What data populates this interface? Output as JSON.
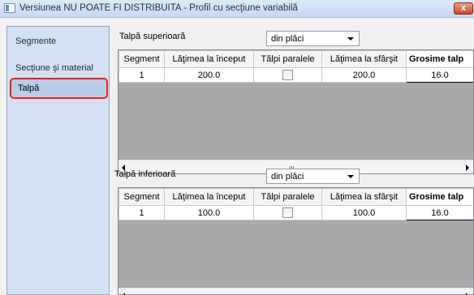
{
  "window": {
    "title": "Versiunea NU POATE FI DISTRIBUITA - Profil cu secţiune variabilă",
    "close_glyph": "x"
  },
  "sidebar": {
    "items": [
      {
        "label": "Segmente"
      },
      {
        "label": "Secţiune şi material"
      },
      {
        "label": "Talpă",
        "selected": true
      }
    ]
  },
  "top_flange": {
    "label": "Talpă superioară",
    "dropdown_value": "din plăci",
    "columns": [
      "Segment",
      "Lăţimea la început",
      "Tălpi paralele",
      "Lăţimea la sfârşit",
      "Grosime talp"
    ],
    "rows": [
      {
        "segment": "1",
        "start_width": "200.0",
        "parallel": false,
        "end_width": "200.0",
        "thickness": "16.0"
      }
    ]
  },
  "bottom_flange": {
    "label": "Talpă inferioară",
    "dropdown_value": "din plăci",
    "columns": [
      "Segment",
      "Lăţimea la început",
      "Tălpi paralele",
      "Lăţimea la sfârşit",
      "Grosime talp"
    ],
    "rows": [
      {
        "segment": "1",
        "start_width": "100.0",
        "parallel": false,
        "end_width": "100.0",
        "thickness": "16.0"
      }
    ]
  },
  "scroll_thumb_glyph": "III"
}
